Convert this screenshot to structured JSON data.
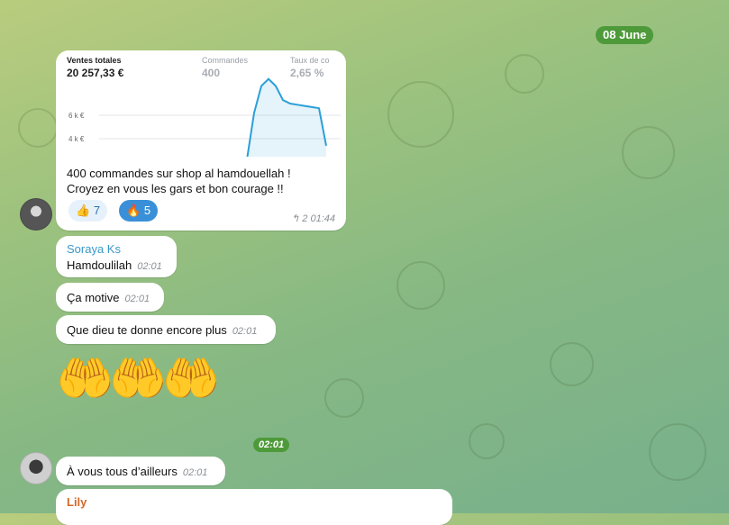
{
  "date_separator": "08 June",
  "post": {
    "stats": [
      {
        "label": "Ventes totales",
        "value": "20 257,33 €"
      },
      {
        "label": "Commandes",
        "value": "400"
      },
      {
        "label": "Taux de co",
        "value": "2,65 %"
      }
    ],
    "chart_data": {
      "type": "area",
      "ytick_labels": [
        "6 k €",
        "4 k €"
      ],
      "y": [
        0,
        0,
        0,
        0,
        0,
        0,
        0,
        0,
        0,
        0.2,
        4.2,
        6.5,
        7.1,
        6.5,
        5.3,
        5.0,
        4.9,
        4.8,
        4.7,
        4.6,
        1.4
      ]
    },
    "text_line1": "400 commandes sur shop al hamdouellah !",
    "text_line2": "Croyez en vous les gars et bon courage !!",
    "reactions": [
      {
        "emoji": "👍",
        "count": "7"
      },
      {
        "emoji": "🔥",
        "count": "5"
      }
    ],
    "reply_count": "2",
    "time": "01:44"
  },
  "messages": [
    {
      "sender": "Soraya Ks",
      "text": "Hamdoulilah",
      "time": "02:01"
    },
    {
      "text": "Ça motive",
      "time": "02:01"
    },
    {
      "text": "Que dieu te donne encore plus",
      "time": "02:01"
    }
  ],
  "sticker": {
    "emoji": "🤲🤲🤲",
    "time": "02:01"
  },
  "message_last": {
    "text": "À vous tous d’ailleurs",
    "time": "02:01"
  },
  "partial_sender": "Lily",
  "colors": {
    "accent_green": "#4e9a3a",
    "sender_blue": "#3a98c8",
    "sender_orange": "#d2692a",
    "chart_line": "#2a9fd8"
  }
}
